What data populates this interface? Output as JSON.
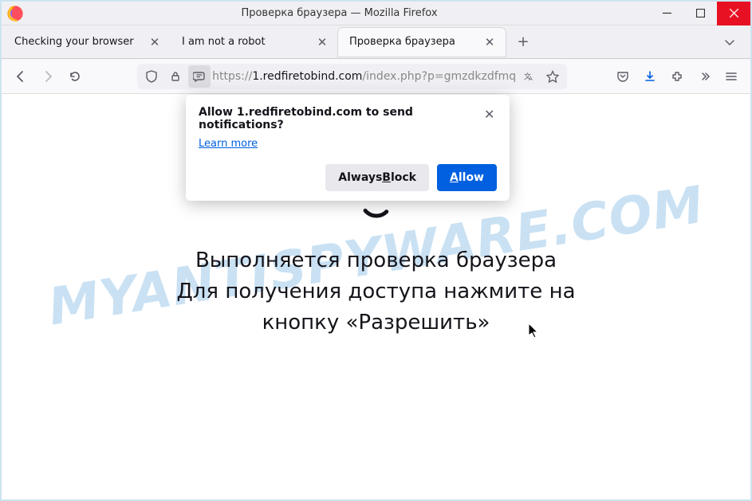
{
  "titlebar": {
    "title": "Проверка браузера — Mozilla Firefox"
  },
  "tabs": [
    {
      "label": "Checking your browser",
      "active": false
    },
    {
      "label": "I am not a robot",
      "active": false
    },
    {
      "label": "Проверка браузера",
      "active": true
    }
  ],
  "url": {
    "scheme": "https://",
    "host": "1.redfiretobind.com",
    "path": "/index.php?p=gmzdkzdfmq"
  },
  "notification": {
    "title": "Allow 1.redfiretobind.com to send notifications?",
    "learn_more": "Learn more",
    "block_label_pre": "Always ",
    "block_label_access": "B",
    "block_label_post": "lock",
    "allow_label_access": "A",
    "allow_label_post": "llow"
  },
  "page": {
    "line1": "Выполняется проверка браузера",
    "line2": "Для получения доступа нажмите на",
    "line3": "кнопку «Разрешить»"
  },
  "watermark": "MYANTISPYWARE.COM"
}
